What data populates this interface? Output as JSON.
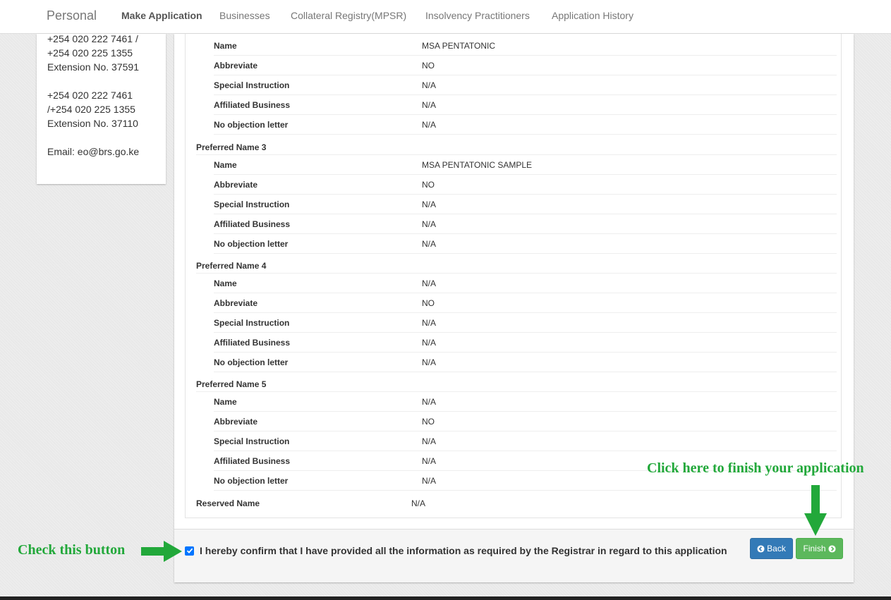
{
  "navbar": {
    "brand": "Personal",
    "links": [
      "Make Application",
      "Businesses",
      "Collateral Registry(MPSR)",
      "Insolvency Practitioners",
      "Application History"
    ],
    "active": "Make Application"
  },
  "contact": {
    "lines": [
      "+254 020 222 7461 /",
      "+254 020 225 1355",
      "Extension No. 37591",
      "+254 020 222 7461",
      "/+254 020 225 1355",
      "Extension No. 37110",
      "Email: eo@brs.go.ke"
    ]
  },
  "field_labels": {
    "name": "Name",
    "abbreviate": "Abbreviate",
    "special": "Special Instruction",
    "affiliated": "Affiliated Business",
    "objection": "No objection letter"
  },
  "preferred_names": [
    {
      "heading": "",
      "name": "MSA PENTATONIC",
      "abbreviate": "NO",
      "special": "N/A",
      "affiliated": "N/A",
      "objection": "N/A"
    },
    {
      "heading": "Preferred Name 3",
      "name": "MSA PENTATONIC SAMPLE",
      "abbreviate": "NO",
      "special": "N/A",
      "affiliated": "N/A",
      "objection": "N/A"
    },
    {
      "heading": "Preferred Name 4",
      "name": "N/A",
      "abbreviate": "NO",
      "special": "N/A",
      "affiliated": "N/A",
      "objection": "N/A"
    },
    {
      "heading": "Preferred Name 5",
      "name": "N/A",
      "abbreviate": "NO",
      "special": "N/A",
      "affiliated": "N/A",
      "objection": "N/A"
    }
  ],
  "reserved": {
    "label": "Reserved Name",
    "value": "N/A"
  },
  "footer": {
    "confirm_text": "I hereby confirm that I have provided all the information as required by the Registrar in regard to this application",
    "confirm_checked": true,
    "back_label": "Back",
    "finish_label": "Finish"
  },
  "annotations": {
    "check": "Check this button",
    "finish": "Click here to finish your application"
  },
  "colors": {
    "back_button": "#337ab7",
    "finish_button": "#5cb85c",
    "annotation": "#22a83a",
    "checkbox": "#0075ff"
  },
  "icons": {
    "back": "chevron-circle-left-icon",
    "finish": "chevron-circle-right-icon",
    "check": "checkmark-icon",
    "arrow_right": "arrow-right-icon",
    "arrow_down": "arrow-down-icon"
  }
}
